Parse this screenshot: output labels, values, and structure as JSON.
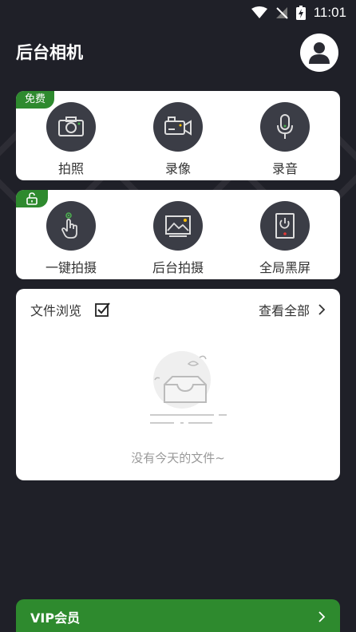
{
  "status_bar": {
    "time": "11:01"
  },
  "header": {
    "title": "后台相机"
  },
  "free_panel": {
    "badge": "免费",
    "items": [
      {
        "label": "拍照",
        "icon": "camera-icon"
      },
      {
        "label": "录像",
        "icon": "video-camera-icon"
      },
      {
        "label": "录音",
        "icon": "microphone-icon"
      }
    ]
  },
  "locked_panel": {
    "badge_icon": "unlock-icon",
    "items": [
      {
        "label": "一键拍摄",
        "icon": "tap-hand-icon"
      },
      {
        "label": "后台拍摄",
        "icon": "picture-icon"
      },
      {
        "label": "全局黑屏",
        "icon": "power-screen-icon"
      }
    ]
  },
  "files": {
    "title": "文件浏览",
    "view_all": "查看全部",
    "empty_text": "没有今天的文件~"
  },
  "vip": {
    "label": "VIP会员"
  },
  "colors": {
    "background": "#1f2028",
    "accent_green": "#2e8a2e",
    "icon_circle": "#3b3d46",
    "card": "#ffffff"
  }
}
